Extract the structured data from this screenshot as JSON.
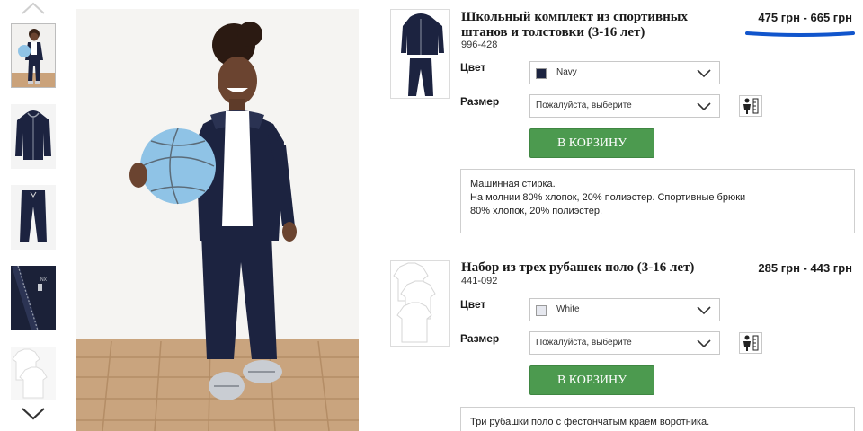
{
  "gallery": {
    "thumbnails": [
      "kid-outfit-photo",
      "zip-hoodie-photo",
      "joggers-photo",
      "zipper-detail-photo",
      "white-polo-shirts-photo"
    ],
    "active_index": 0
  },
  "products": [
    {
      "title_line1": "Школьный комплект из спортивных",
      "title_line2": "штанов и толстовки (3-16 лет)",
      "code": "996-428",
      "price": "475 грн - 665 грн",
      "color_label": "Цвет",
      "color_value": "Navy",
      "color_swatch": "#1c2340",
      "size_label": "Размер",
      "size_value": "Пожалуйста, выберите",
      "cart_label": "В КОРЗИНУ",
      "desc_lines": [
        "Машинная стирка.",
        "На молнии 80% хлопок, 20% полиэстер. Спортивные брюки",
        "80% хлопок, 20% полиэстер."
      ]
    },
    {
      "title_line1": "Набор из трех рубашек поло (3-16 лет)",
      "code": "441-092",
      "price": "285 грн - 443 грн",
      "color_label": "Цвет",
      "color_value": "White",
      "color_swatch": "#e6e8ef",
      "size_label": "Размер",
      "size_value": "Пожалуйста, выберите",
      "cart_label": "В КОРЗИНУ",
      "desc_lines": [
        "Три рубашки поло с фестончатым краем воротника."
      ]
    }
  ],
  "colors": {
    "cart_button": "#4c9a4f",
    "annotation_underline": "#1155cc",
    "navy_garment": "#1c2340"
  }
}
